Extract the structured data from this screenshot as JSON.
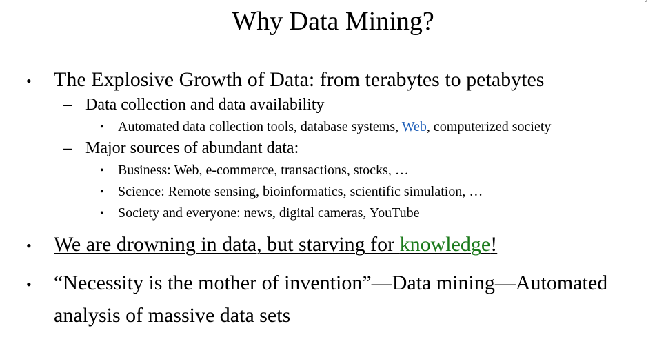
{
  "slide": {
    "title": "Why Data Mining?",
    "bullets": [
      {
        "text": "The Explosive Growth of Data: from terabytes to petabytes",
        "sub": [
          {
            "text": "Data collection and data availability",
            "items": [
              {
                "prefix": "Automated data collection tools, database systems, ",
                "link": "Web",
                "suffix": ", computerized society"
              }
            ]
          },
          {
            "text": "Major sources of abundant data:",
            "items": [
              {
                "text": "Business: Web, e-commerce, transactions, stocks, …"
              },
              {
                "text": "Science: Remote sensing, bioinformatics, scientific simulation, …"
              },
              {
                "text": "Society and everyone: news, digital cameras, YouTube"
              }
            ]
          }
        ]
      },
      {
        "prefix": "We are drowning in data, but starving for ",
        "highlight": "knowledge",
        "suffix": "!"
      },
      {
        "line1": "“Necessity is the mother of invention”—Data mining—Automated",
        "line2": "analysis of massive data sets"
      }
    ],
    "bullet_symbols": {
      "level1": "•",
      "level2": "–",
      "level3": "•"
    },
    "colors": {
      "link": "#1f5fb8",
      "highlight": "#1b7a1b",
      "text": "#000000"
    }
  }
}
